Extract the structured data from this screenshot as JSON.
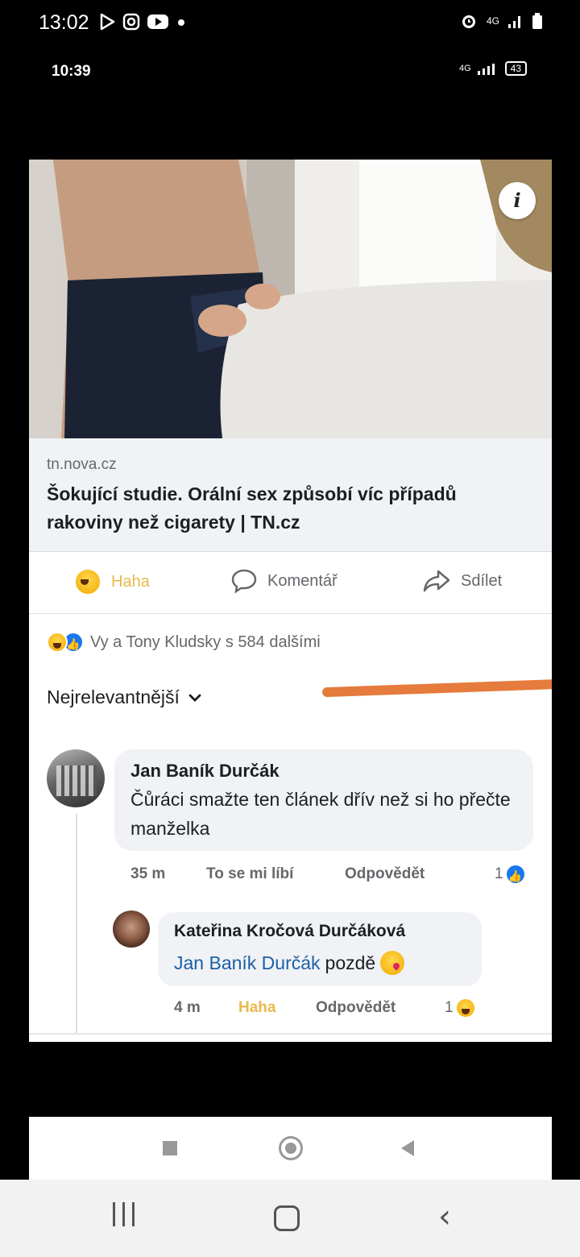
{
  "outer_status": {
    "time": "13:02",
    "network": "4G",
    "icons": [
      "play-store-icon",
      "instagram-icon",
      "youtube-icon",
      "dot-icon",
      "alarm-icon",
      "signal-icon",
      "battery-icon"
    ]
  },
  "inner_status": {
    "time": "10:39",
    "network": "4G",
    "battery": "43"
  },
  "post": {
    "link": {
      "domain": "tn.nova.cz",
      "title": "Šokující studie. Orální sex způsobí víc případů rakoviny než cigarety | TN.cz"
    },
    "actions": {
      "haha": "Haha",
      "comment": "Komentář",
      "share": "Sdílet"
    },
    "reactions_text": "Vy a Tony Kludsky s 584 dalšími",
    "sort_label": "Nejrelevantnější",
    "comments": [
      {
        "author": "Jan Baník Durčák",
        "text": "Čůráci smažte ten článek dřív než si ho přečte manželka",
        "time": "35 m",
        "like_label": "To se mi líbí",
        "reply_label": "Odpovědět",
        "count": "1"
      },
      {
        "author": "Kateřina Kročová Durčáková",
        "mention": "Jan Baník Durčák",
        "text": "pozdě",
        "time": "4 m",
        "like_label": "Haha",
        "reply_label": "Odpovědět",
        "count": "1"
      }
    ]
  },
  "colors": {
    "haha": "#e9b94a",
    "like": "#1877f2",
    "mention": "#1d5fa8",
    "annotation": "#e57b3c"
  }
}
